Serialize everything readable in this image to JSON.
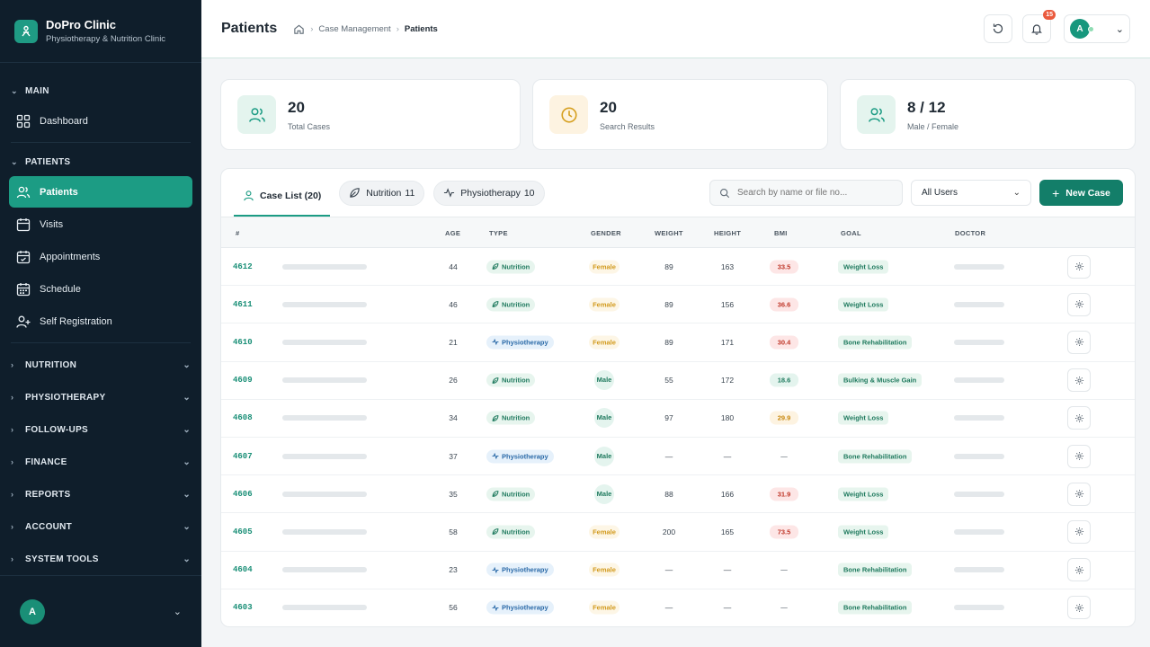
{
  "brand": {
    "title": "DoPro Clinic",
    "subtitle": "Physiotherapy & Nutrition Clinic"
  },
  "sidebar": {
    "main_label": "MAIN",
    "main_items": [
      {
        "label": "Dashboard",
        "icon": "grid-icon"
      }
    ],
    "patients_label": "PATIENTS",
    "patients_items": [
      {
        "label": "Patients",
        "icon": "users-icon",
        "active": true
      },
      {
        "label": "Visits",
        "icon": "calendar-icon"
      },
      {
        "label": "Appointments",
        "icon": "calendar-check-icon"
      },
      {
        "label": "Schedule",
        "icon": "calendar-grid-icon"
      },
      {
        "label": "Self Registration",
        "icon": "user-plus-icon"
      }
    ],
    "groups": [
      "NUTRITION",
      "PHYSIOTHERAPY",
      "FOLLOW-UPS",
      "FINANCE",
      "REPORTS",
      "ACCOUNT",
      "SYSTEM TOOLS"
    ],
    "user_initial": "A"
  },
  "header": {
    "title": "Patients",
    "breadcrumb": [
      "Case Management",
      "Patients"
    ],
    "notifications": "15",
    "user_initial": "A"
  },
  "stats": [
    {
      "value": "20",
      "label": "Total Cases",
      "icon": "users-icon"
    },
    {
      "value": "20",
      "label": "Search Results",
      "icon": "clock-icon"
    },
    {
      "value": "8 / 12",
      "label": "Male / Female",
      "icon": "users-icon"
    }
  ],
  "tabs": [
    {
      "label": "Case List (20)"
    },
    {
      "label": "Nutrition",
      "count": "11"
    },
    {
      "label": "Physiotherapy",
      "count": "10"
    }
  ],
  "search": {
    "placeholder": "Search by name or file no..."
  },
  "filter": {
    "selected": "All Users"
  },
  "new_case_label": "New Case",
  "table": {
    "columns": [
      "#",
      "AGE",
      "TYPE",
      "GENDER",
      "WEIGHT",
      "HEIGHT",
      "BMI",
      "GOAL",
      "DOCTOR"
    ],
    "rows": [
      {
        "id": "4612",
        "age": "44",
        "type": "Nutrition",
        "gender": "Female",
        "weight": "89",
        "height": "163",
        "bmi": "33.5",
        "bmi_level": "red",
        "goal": "Weight Loss"
      },
      {
        "id": "4611",
        "age": "46",
        "type": "Nutrition",
        "gender": "Female",
        "weight": "89",
        "height": "156",
        "bmi": "36.6",
        "bmi_level": "red",
        "goal": "Weight Loss"
      },
      {
        "id": "4610",
        "age": "21",
        "type": "Physiotherapy",
        "gender": "Female",
        "weight": "89",
        "height": "171",
        "bmi": "30.4",
        "bmi_level": "red",
        "goal": "Bone Rehabilitation"
      },
      {
        "id": "4609",
        "age": "26",
        "type": "Nutrition",
        "gender": "Male",
        "weight": "55",
        "height": "172",
        "bmi": "18.6",
        "bmi_level": "green",
        "goal": "Bulking & Muscle Gain"
      },
      {
        "id": "4608",
        "age": "34",
        "type": "Nutrition",
        "gender": "Male",
        "weight": "97",
        "height": "180",
        "bmi": "29.9",
        "bmi_level": "amber",
        "goal": "Weight Loss"
      },
      {
        "id": "4607",
        "age": "37",
        "type": "Physiotherapy",
        "gender": "Male",
        "weight": "—",
        "height": "—",
        "bmi": "—",
        "bmi_level": "none",
        "goal": "Bone Rehabilitation"
      },
      {
        "id": "4606",
        "age": "35",
        "type": "Nutrition",
        "gender": "Male",
        "weight": "88",
        "height": "166",
        "bmi": "31.9",
        "bmi_level": "red",
        "goal": "Weight Loss"
      },
      {
        "id": "4605",
        "age": "58",
        "type": "Nutrition",
        "gender": "Female",
        "weight": "200",
        "height": "165",
        "bmi": "73.5",
        "bmi_level": "red",
        "goal": "Weight Loss"
      },
      {
        "id": "4604",
        "age": "23",
        "type": "Physiotherapy",
        "gender": "Female",
        "weight": "—",
        "height": "—",
        "bmi": "—",
        "bmi_level": "none",
        "goal": "Bone Rehabilitation"
      },
      {
        "id": "4603",
        "age": "56",
        "type": "Physiotherapy",
        "gender": "Female",
        "weight": "—",
        "height": "—",
        "bmi": "—",
        "bmi_level": "none",
        "goal": "Bone Rehabilitation"
      }
    ]
  },
  "colors": {
    "accent": "#1c9c84",
    "sidebar": "#0f1e2b",
    "primary_button": "#137e69"
  }
}
